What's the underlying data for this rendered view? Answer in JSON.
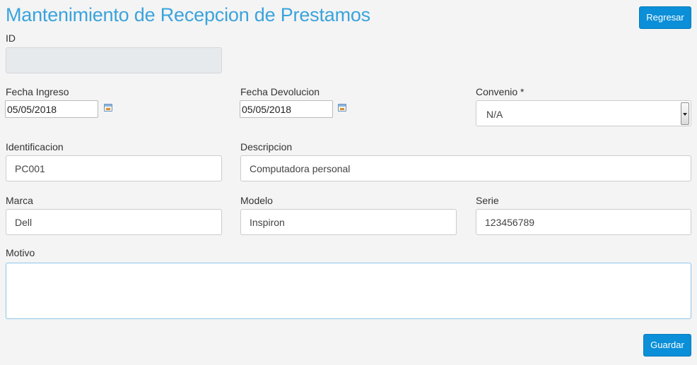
{
  "header": {
    "title": "Mantenimiento de Recepcion de Prestamos",
    "back_label": "Regresar"
  },
  "form": {
    "id": {
      "label": "ID",
      "value": ""
    },
    "fecha_ingreso": {
      "label": "Fecha Ingreso",
      "value": "05/05/2018"
    },
    "fecha_devolucion": {
      "label": "Fecha Devolucion",
      "value": "05/05/2018"
    },
    "convenio": {
      "label": "Convenio *",
      "value": "N/A"
    },
    "identificacion": {
      "label": "Identificacion",
      "value": "PC001"
    },
    "descripcion": {
      "label": "Descripcion",
      "value": "Computadora personal"
    },
    "marca": {
      "label": "Marca",
      "value": "Dell"
    },
    "modelo": {
      "label": "Modelo",
      "value": "Inspiron"
    },
    "serie": {
      "label": "Serie",
      "value": "123456789"
    },
    "motivo": {
      "label": "Motivo",
      "value": ""
    }
  },
  "footer": {
    "save_label": "Guardar"
  },
  "colors": {
    "title": "#3aa3dc",
    "button": "#0a8fd8",
    "background": "#f4f4f4"
  }
}
